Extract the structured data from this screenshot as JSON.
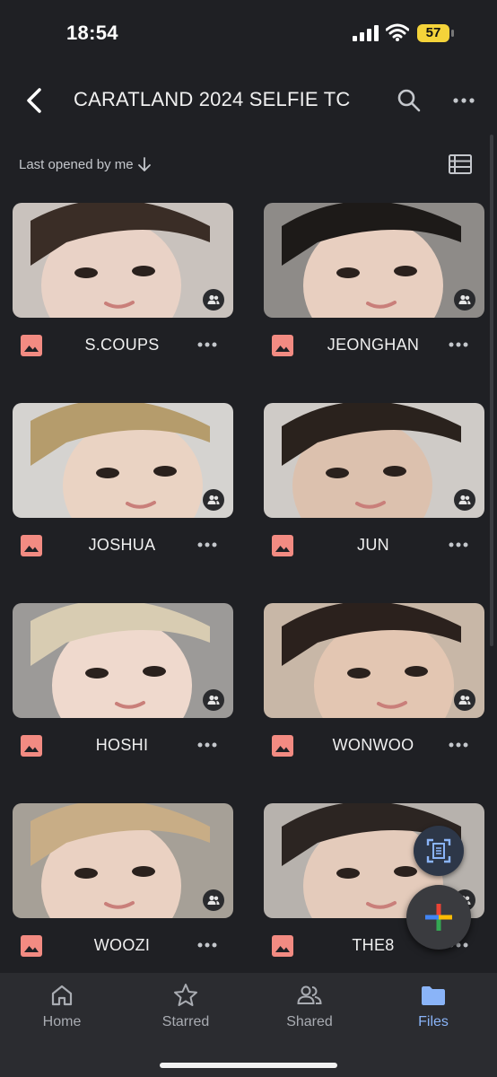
{
  "status_bar": {
    "time": "18:54",
    "battery": "57"
  },
  "header": {
    "title": "CARATLAND 2024 SELFIE TC"
  },
  "sort": {
    "label": "Last opened by me"
  },
  "files": [
    {
      "name": "S.COUPS",
      "skin": "#e9d2c6",
      "bg": "#c9c2bd",
      "hair": "#3a2d26"
    },
    {
      "name": "JEONGHAN",
      "skin": "#e8cfc0",
      "bg": "#8e8b88",
      "hair": "#1d1a18"
    },
    {
      "name": "JOSHUA",
      "skin": "#ead3c3",
      "bg": "#d5d3d0",
      "hair": "#b59c6c"
    },
    {
      "name": "JUN",
      "skin": "#dcc1ae",
      "bg": "#cfcbc7",
      "hair": "#2a221d"
    },
    {
      "name": "HOSHI",
      "skin": "#efd9cd",
      "bg": "#9c9a98",
      "hair": "#d8ccb2"
    },
    {
      "name": "WONWOO",
      "skin": "#e3c6b2",
      "bg": "#c8b7a7",
      "hair": "#2b211d"
    },
    {
      "name": "WOOZI",
      "skin": "#ead1c2",
      "bg": "#a6a097",
      "hair": "#c8ad86"
    },
    {
      "name": "THE8",
      "skin": "#e4cbbb",
      "bg": "#b7b2ad",
      "hair": "#2c2522"
    }
  ],
  "nav": [
    {
      "label": "Home",
      "icon": "home-icon"
    },
    {
      "label": "Starred",
      "icon": "star-icon"
    },
    {
      "label": "Shared",
      "icon": "people-icon"
    },
    {
      "label": "Files",
      "icon": "folder-icon",
      "active": true
    }
  ],
  "colors": {
    "accent": "#8ab4f8",
    "image_file_icon": "#f28b82",
    "background": "#1f2024"
  }
}
